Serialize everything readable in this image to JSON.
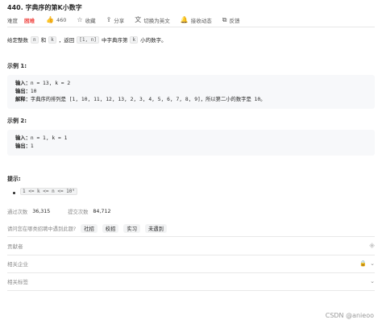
{
  "problem": {
    "title": "440. 字典序的第K小数字",
    "difficulty_label": "难度",
    "difficulty": "困难",
    "likes": "460",
    "favorite": "收藏",
    "share": "分享",
    "switch_lang": "切换为英文",
    "subscribe": "接收动态",
    "feedback": "反馈",
    "accent_color": "#ef4743"
  },
  "description": {
    "t1": "给定整数",
    "n": "n",
    "t2": "和",
    "k": "k",
    "t3": "，返回",
    "range": "[1, n]",
    "t4": "中字典序第",
    "k2": "k",
    "t5": "小的数字。"
  },
  "example1": {
    "heading": "示例 1:",
    "input_label": "输入：",
    "input": "n = 13, k = 2",
    "output_label": "输出：",
    "output": "10",
    "explain_label": "解释：",
    "explain": "字典序的排列是 [1, 10, 11, 12, 13, 2, 3, 4, 5, 6, 7, 8, 9]，所以第二小的数字是 10。"
  },
  "example2": {
    "heading": "示例 2:",
    "input_label": "输入：",
    "input": "n = 1, k = 1",
    "output_label": "输出：",
    "output": "1"
  },
  "hints": {
    "heading": "提示:",
    "items": [
      "1 <= k <= n <= 10⁹"
    ]
  },
  "stats": {
    "passed_label": "通过次数",
    "passed": "36,315",
    "submitted_label": "提交次数",
    "submitted": "84,712"
  },
  "interview": {
    "question": "请问您在哪类招聘中遇到此题?",
    "tags": [
      "社招",
      "校招",
      "实习",
      "未遇到"
    ]
  },
  "sections": {
    "contributors": "贡献者",
    "companies": "相关企业",
    "tags": "相关标签"
  },
  "watermark": "CSDN @anieoo"
}
